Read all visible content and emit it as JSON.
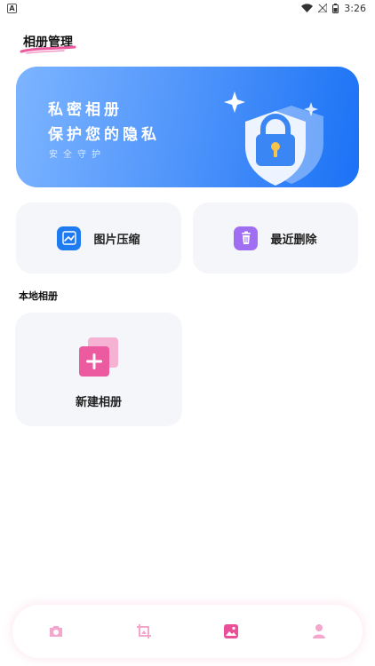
{
  "status_bar": {
    "left_icon": "A",
    "time": "3:26",
    "icons": [
      "wifi-icon",
      "signal-off-icon",
      "battery-icon"
    ]
  },
  "header": {
    "title": "相册管理"
  },
  "banner": {
    "title": "私密相册",
    "subtitle": "保护您的隐私",
    "tagline": "安全守护"
  },
  "features": {
    "compress_label": "图片压缩",
    "recent_delete_label": "最近删除"
  },
  "local_section": {
    "title": "本地相册",
    "new_album_label": "新建相册"
  },
  "bottom_nav": {
    "items": [
      "camera-icon",
      "crop-icon",
      "gallery-icon",
      "profile-icon"
    ],
    "active_index": 2
  },
  "colors": {
    "accent_pink": "#ec5aa0",
    "banner_blue": "#1a72f5",
    "compress_blue": "#1f7cf0",
    "trash_purple": "#a06ef2",
    "card_bg": "#f4f6f9"
  }
}
